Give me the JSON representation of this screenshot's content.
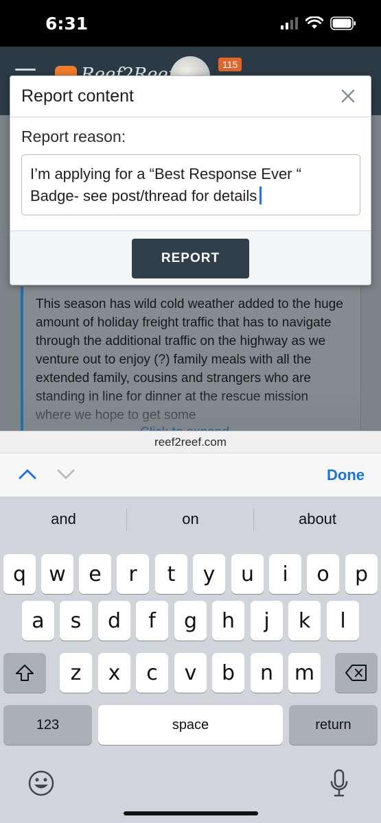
{
  "status": {
    "time": "6:31"
  },
  "site": {
    "notification_count": "115"
  },
  "background": {
    "quote_text": "This season has wild cold weather added to the huge amount of holiday freight traffic that has to navigate through the additional traffic on the highway as we venture out to enjoy (?) family meals with all the extended family, cousins and strangers who are standing in line for dinner at the rescue mission where we hope to get some",
    "click_to_expand": "Click to expand..."
  },
  "dialog": {
    "title": "Report content",
    "reason_label": "Report reason:",
    "reason_value": "I’m applying for a “Best Response Ever “ Badge- see post/thread for details",
    "report_button": "REPORT"
  },
  "browser": {
    "url": "reef2reef.com"
  },
  "accessory": {
    "done": "Done"
  },
  "keyboard": {
    "suggestions": [
      "and",
      "on",
      "about"
    ],
    "row1": [
      "q",
      "w",
      "e",
      "r",
      "t",
      "y",
      "u",
      "i",
      "o",
      "p"
    ],
    "row2": [
      "a",
      "s",
      "d",
      "f",
      "g",
      "h",
      "j",
      "k",
      "l"
    ],
    "row3": [
      "z",
      "x",
      "c",
      "v",
      "b",
      "n",
      "m"
    ],
    "numbers_key": "123",
    "space_key": "space",
    "return_key": "return"
  }
}
